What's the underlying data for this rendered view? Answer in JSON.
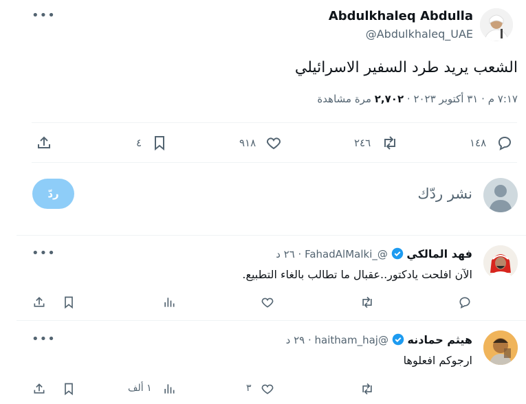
{
  "main_tweet": {
    "author_name": "Abdulkhaleq Abdulla",
    "author_handle": "@Abdulkhaleq_UAE",
    "text": "الشعب يريد طرد السفير الاسرائيلي",
    "time": "٧:١٧ م",
    "date": "٣١ أكتوبر ٢٠٢٣",
    "views_count": "٢,٧٠٢",
    "views_label": "مرة مشاهدة",
    "replies": "١٤٨",
    "retweets": "٢٤٦",
    "likes": "٩١٨",
    "bookmarks": "٤"
  },
  "composer": {
    "placeholder": "نشر ردّك",
    "reply_button": "ردّ"
  },
  "replies": [
    {
      "name": "فهد المالكي",
      "handle": "@_FahadAlMalki",
      "age": "٢٦ د",
      "text": "الآن افلحت يادكتور..عقبال ما تطالب بالغاء التطبيع.",
      "views": ""
    },
    {
      "name": "هيثم حمادنه",
      "handle": "@haitham_haj",
      "age": "٢٩ د",
      "text": "ارجوكم افعلوها",
      "likes": "٣",
      "views": "١ ألف"
    }
  ],
  "colors": {
    "accent": "#1d9bf0",
    "reply_button": "#8ecdf8",
    "muted": "#536471"
  }
}
